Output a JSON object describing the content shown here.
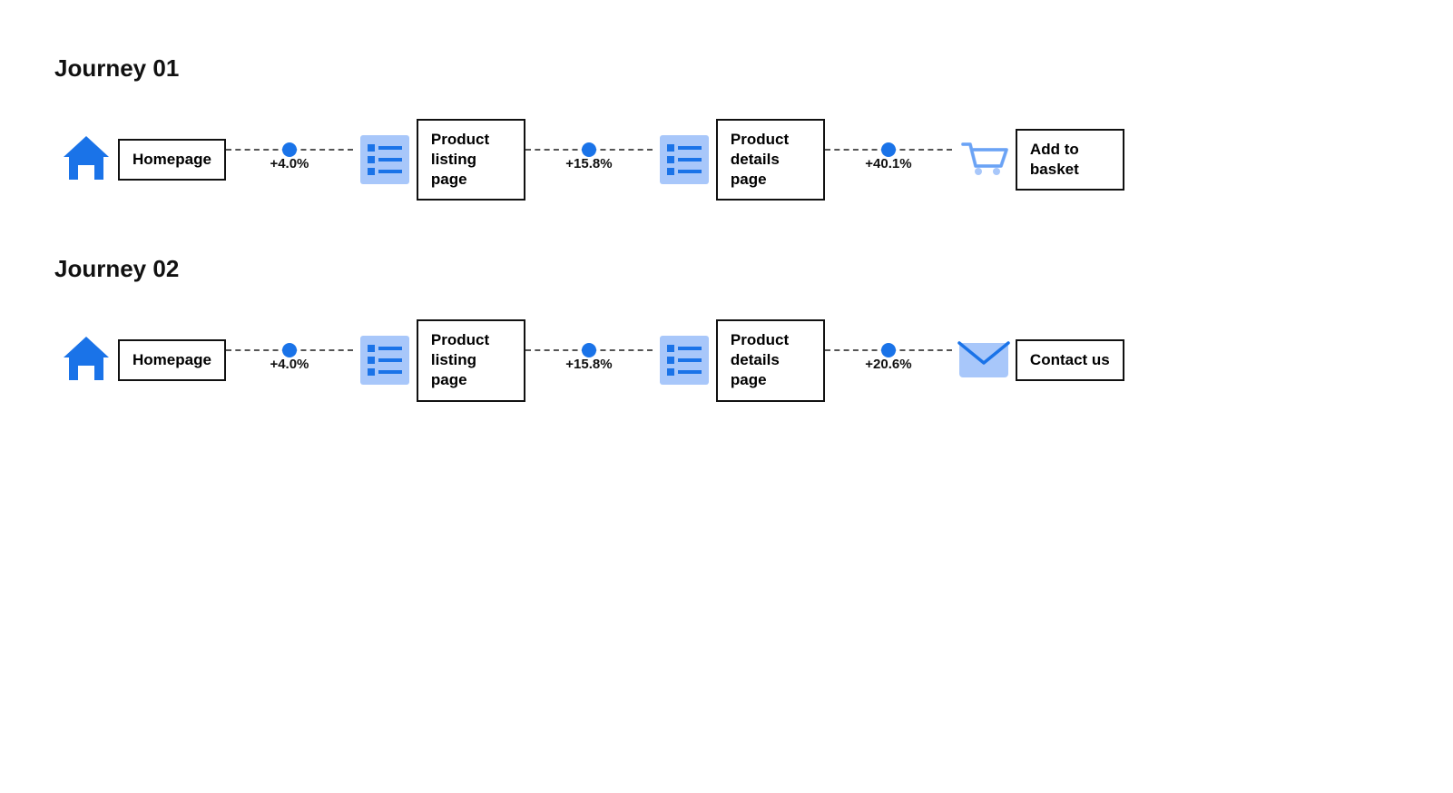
{
  "journeys": [
    {
      "id": "journey-01",
      "title": "Journey 01",
      "nodes": [
        {
          "id": "homepage-1",
          "icon": "home",
          "label": "Homepage"
        },
        {
          "id": "listing-1",
          "icon": "listing",
          "label": "Product listing page"
        },
        {
          "id": "details-1",
          "icon": "details",
          "label": "Product details page"
        },
        {
          "id": "basket-1",
          "icon": "basket",
          "label": "Add to basket"
        }
      ],
      "connectors": [
        {
          "id": "c1-1",
          "percent": "+4.0%"
        },
        {
          "id": "c1-2",
          "percent": "+15.8%"
        },
        {
          "id": "c1-3",
          "percent": "+40.1%"
        }
      ]
    },
    {
      "id": "journey-02",
      "title": "Journey 02",
      "nodes": [
        {
          "id": "homepage-2",
          "icon": "home",
          "label": "Homepage"
        },
        {
          "id": "listing-2",
          "icon": "listing",
          "label": "Product listing page"
        },
        {
          "id": "details-2",
          "icon": "details",
          "label": "Product details page"
        },
        {
          "id": "contact-2",
          "icon": "contact",
          "label": "Contact us"
        }
      ],
      "connectors": [
        {
          "id": "c2-1",
          "percent": "+4.0%"
        },
        {
          "id": "c2-2",
          "percent": "+15.8%"
        },
        {
          "id": "c2-3",
          "percent": "+20.6%"
        }
      ]
    }
  ],
  "colors": {
    "blue_dark": "#1a73e8",
    "blue_light": "#a8c7fa",
    "blue_mid": "#6aa3f5"
  }
}
